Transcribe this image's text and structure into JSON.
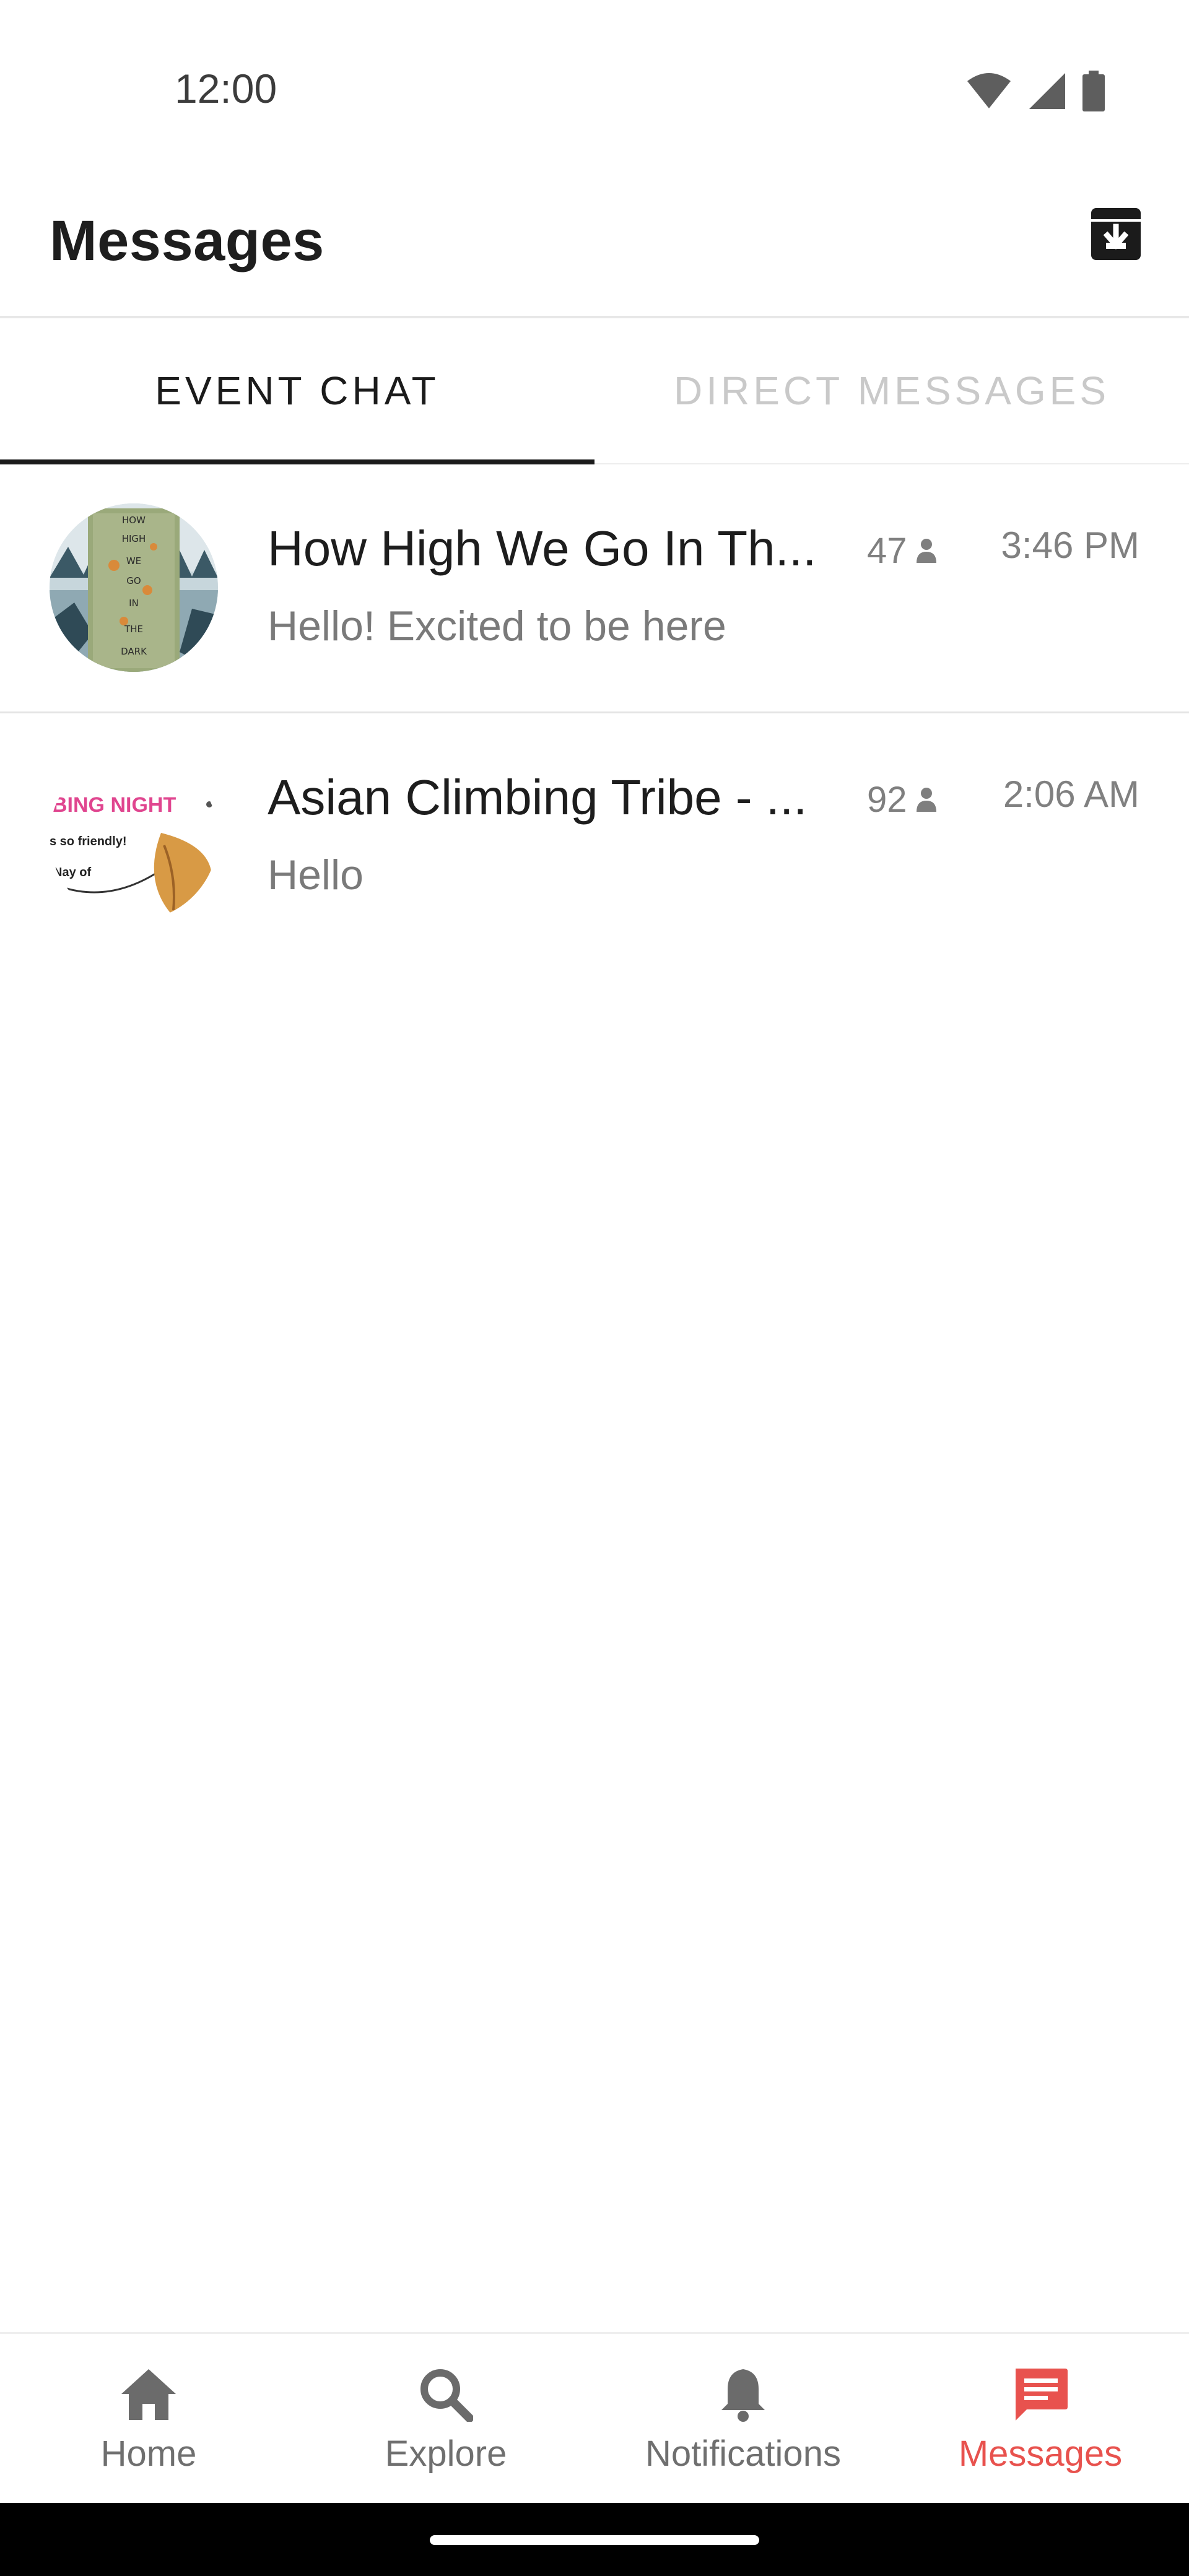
{
  "status_bar": {
    "time": "12:00",
    "icons": [
      "wifi-icon",
      "cellular-signal-icon",
      "battery-icon"
    ]
  },
  "app_bar": {
    "title": "Messages",
    "archive_icon": "archive-icon"
  },
  "tabs": [
    {
      "label": "EVENT CHAT",
      "active": true
    },
    {
      "label": "DIRECT MESSAGES",
      "active": false
    }
  ],
  "chats": [
    {
      "title": "How High We Go In Th...",
      "preview": "Hello! Excited to be here",
      "member_count": "47",
      "time": "3:46 PM",
      "avatar_text": [
        "HOW",
        "HIGH",
        "WE",
        "GO",
        "IN",
        "THE",
        "DARK"
      ]
    },
    {
      "title": "Asian Climbing Tribe - ...",
      "preview": "Hello",
      "member_count": "92",
      "time": "2:06 AM",
      "avatar_text": [
        "BING NIGHT",
        "s so friendly!",
        "Nay of"
      ]
    }
  ],
  "bottom_nav": [
    {
      "label": "Home",
      "icon": "home-icon",
      "active": false
    },
    {
      "label": "Explore",
      "icon": "search-icon",
      "active": false
    },
    {
      "label": "Notifications",
      "icon": "bell-icon",
      "active": false
    },
    {
      "label": "Messages",
      "icon": "chat-icon",
      "active": true
    }
  ],
  "colors": {
    "accent": "#e8524e",
    "text_primary": "#1b1b1b",
    "text_secondary": "#7a7a7a",
    "tab_inactive": "#c9c9c9"
  }
}
